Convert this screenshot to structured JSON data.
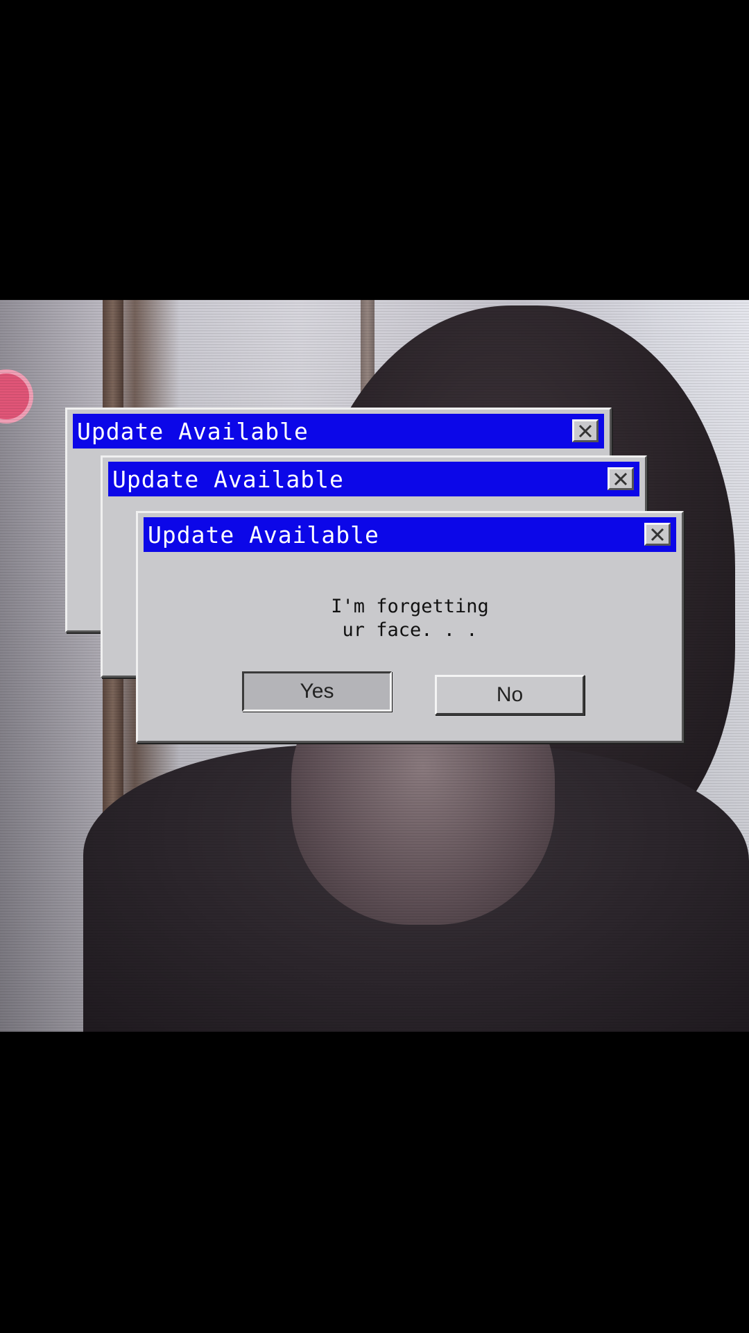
{
  "dialogs": [
    {
      "title": "Update Available",
      "close_icon": "close-icon"
    },
    {
      "title": "Update Available",
      "close_icon": "close-icon"
    },
    {
      "title": "Update Available",
      "close_icon": "close-icon",
      "message_line1": "I'm forgetting",
      "message_line2": "ur face. . .",
      "yes_label": "Yes",
      "no_label": "No"
    }
  ],
  "colors": {
    "titlebar": "#0c07e8",
    "dialog_face": "#c9c9cc",
    "letterbox": "#000000"
  }
}
